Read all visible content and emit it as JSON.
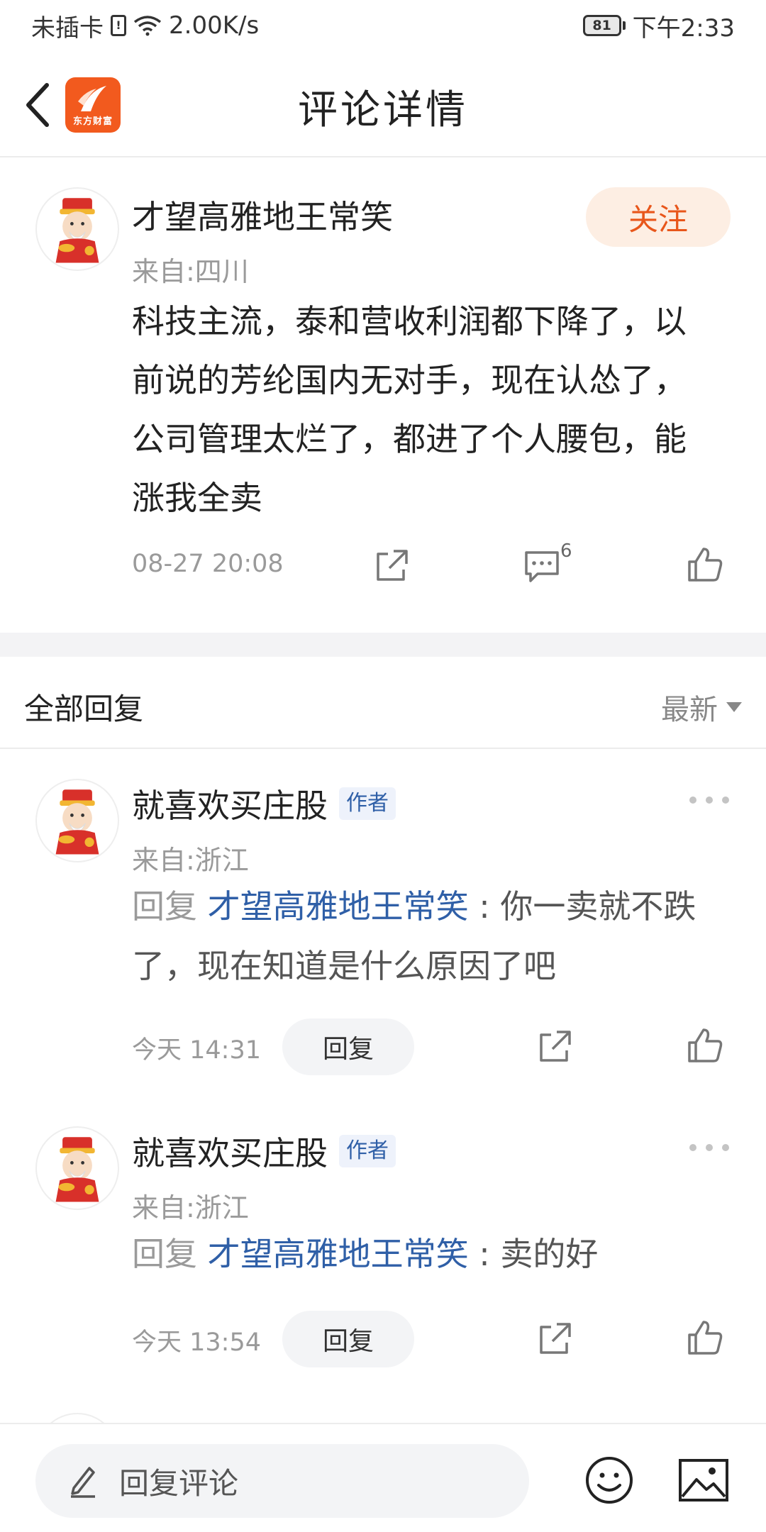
{
  "status_bar": {
    "carrier": "未插卡",
    "sim_mark": "!",
    "network_speed": "2.00K/s",
    "battery": "81",
    "time": "下午2:33"
  },
  "header": {
    "title": "评论详情",
    "logo_text": "东方财富"
  },
  "main_comment": {
    "username": "才望高雅地王常笑",
    "follow_label": "关注",
    "location": "来自:四川",
    "text": "科技主流，泰和营收利润都下降了，以前说的芳纶国内无对手，现在认怂了，公司管理太烂了，都进了个人腰包，能涨我全卖",
    "time": "08-27 20:08",
    "comment_count": "6"
  },
  "replies_header": {
    "title": "全部回复",
    "sort_label": "最新"
  },
  "replies": [
    {
      "username": "就喜欢买庄股",
      "badge": "作者",
      "location": "来自:浙江",
      "prefix": "回复",
      "mention": "才望高雅地王常笑",
      "colon": ":",
      "text": "你一卖就不跌了，现在知道是什么原因了吧",
      "time": "今天 14:31",
      "reply_label": "回复"
    },
    {
      "username": "就喜欢买庄股",
      "badge": "作者",
      "location": "来自:浙江",
      "prefix": "回复",
      "mention": "才望高雅地王常笑",
      "colon": ":",
      "text": "卖的好",
      "time": "今天 13:54",
      "reply_label": "回复"
    }
  ],
  "bottom_bar": {
    "input_placeholder": "回复评论"
  },
  "colors": {
    "accent_orange": "#e8561b",
    "mention_blue": "#2f5fa7"
  }
}
